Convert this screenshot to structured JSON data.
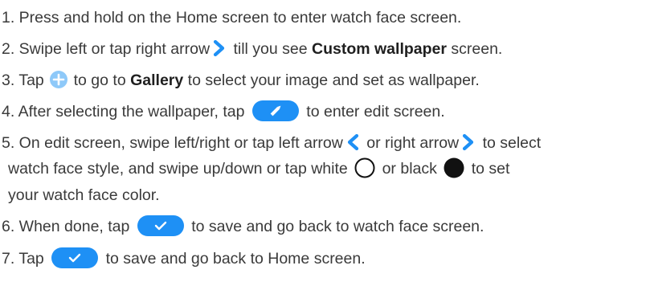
{
  "colors": {
    "text": "#3a3a3a",
    "accent_blue": "#1e90f5",
    "light_blue": "#8ec9f9",
    "black": "#111111"
  },
  "steps": {
    "s1": {
      "text": "1. Press and hold on the Home screen to enter watch face screen."
    },
    "s2": {
      "a": "2. Swipe left or tap right arrow",
      "b": " till you see ",
      "c": "Custom wallpaper",
      "d": " screen."
    },
    "s3": {
      "a": "3. Tap",
      "b": " to go to ",
      "c": "Gallery",
      "d": " to select your image and set as wallpaper."
    },
    "s4": {
      "a": "4. After selecting the wallpaper, tap",
      "b": " to enter edit screen."
    },
    "s5": {
      "a": "5. On edit screen, swipe left/right or tap left arrow",
      "b": " or right arrow",
      "c": " to select",
      "d": "watch face style, and swipe up/down or tap white",
      "e": " or black",
      "f": " to set",
      "g": "your watch face color."
    },
    "s6": {
      "a": "6. When done, tap",
      "b": " to save and go back to watch face screen."
    },
    "s7": {
      "a": "7. Tap",
      "b": " to save and go back to Home screen."
    }
  },
  "icons": {
    "right_arrow": "chevron-right-icon",
    "left_arrow": "chevron-left-icon",
    "add": "plus-icon",
    "edit": "pencil-icon",
    "confirm": "checkmark-icon",
    "white_color": "white-circle-icon",
    "black_color": "black-circle-icon"
  }
}
